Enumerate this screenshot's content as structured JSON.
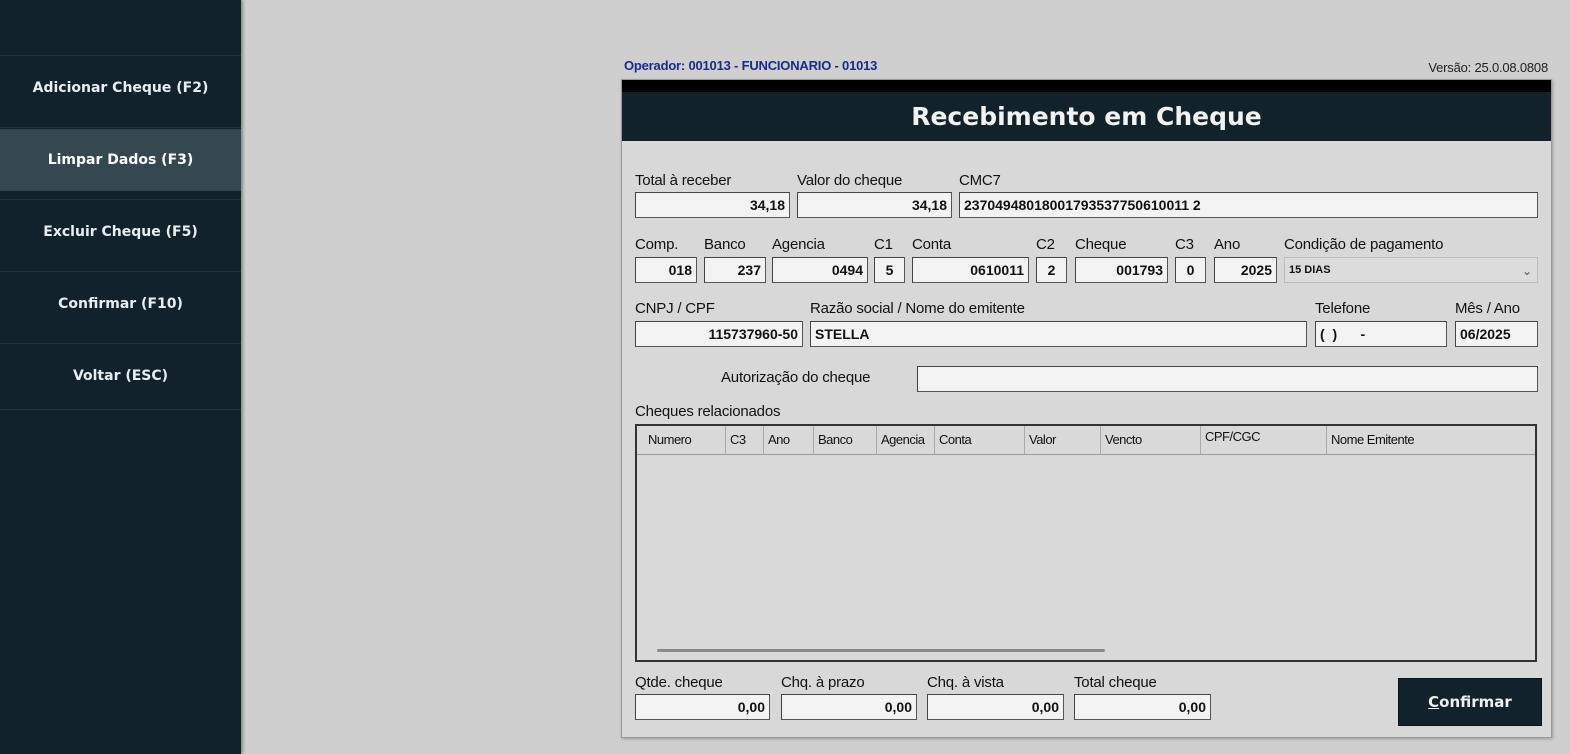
{
  "sidebar": {
    "items": [
      {
        "label": "Adicionar Cheque (F2)"
      },
      {
        "label": "Limpar Dados (F3)"
      },
      {
        "label": "Excluir Cheque (F5)"
      },
      {
        "label": "Confirmar (F10)"
      },
      {
        "label": "Voltar (ESC)"
      }
    ],
    "active_index": 1
  },
  "header": {
    "operator": "Operador: 001013 - FUNCIONARIO - 01013",
    "version": "Versão: 25.0.08.0808"
  },
  "dialog": {
    "title": "Recebimento em Cheque",
    "row1": {
      "total_label": "Total à receber",
      "total_value": "34,18",
      "valor_label": "Valor do cheque",
      "valor_value": "34,18",
      "cmc7_label": "CMC7",
      "cmc7_value": "23704948018001793537750610011 2"
    },
    "row2": {
      "comp_label": "Comp.",
      "comp_value": "018",
      "banco_label": "Banco",
      "banco_value": "237",
      "agencia_label": "Agencia",
      "agencia_value": "0494",
      "c1_label": "C1",
      "c1_value": "5",
      "conta_label": "Conta",
      "conta_value": "0610011",
      "c2_label": "C2",
      "c2_value": "2",
      "cheque_label": "Cheque",
      "cheque_value": "001793",
      "c3_label": "C3",
      "c3_value": "0",
      "ano_label": "Ano",
      "ano_value": "2025",
      "condicao_label": "Condição de pagamento",
      "condicao_value": "15 DIAS"
    },
    "row3": {
      "cnpj_label": "CNPJ / CPF",
      "cnpj_value": "115737960-50",
      "razao_label": "Razão social / Nome do emitente",
      "razao_value": "STELLA",
      "telefone_label": "Telefone",
      "telefone_value": "(  )      -",
      "mesano_label": "Mês / Ano",
      "mesano_value": "06/2025"
    },
    "autorizacao_label": "Autorização do cheque",
    "autorizacao_value": "",
    "grid": {
      "title": "Cheques relacionados",
      "columns": [
        "Numero",
        "C3",
        "Ano",
        "Banco",
        "Agencia",
        "Conta",
        "Valor",
        "Vencto",
        "CPF/CGC",
        "Nome Emitente"
      ],
      "rows": []
    },
    "totals": {
      "qtde_label": "Qtde. cheque",
      "qtde_value": "0,00",
      "prazo_label": "Chq. à prazo",
      "prazo_value": "0,00",
      "vista_label": "Chq. à vista",
      "vista_value": "0,00",
      "total_label": "Total cheque",
      "total_value": "0,00"
    },
    "confirm_button": {
      "accel": "C",
      "rest": "onfirmar"
    }
  }
}
